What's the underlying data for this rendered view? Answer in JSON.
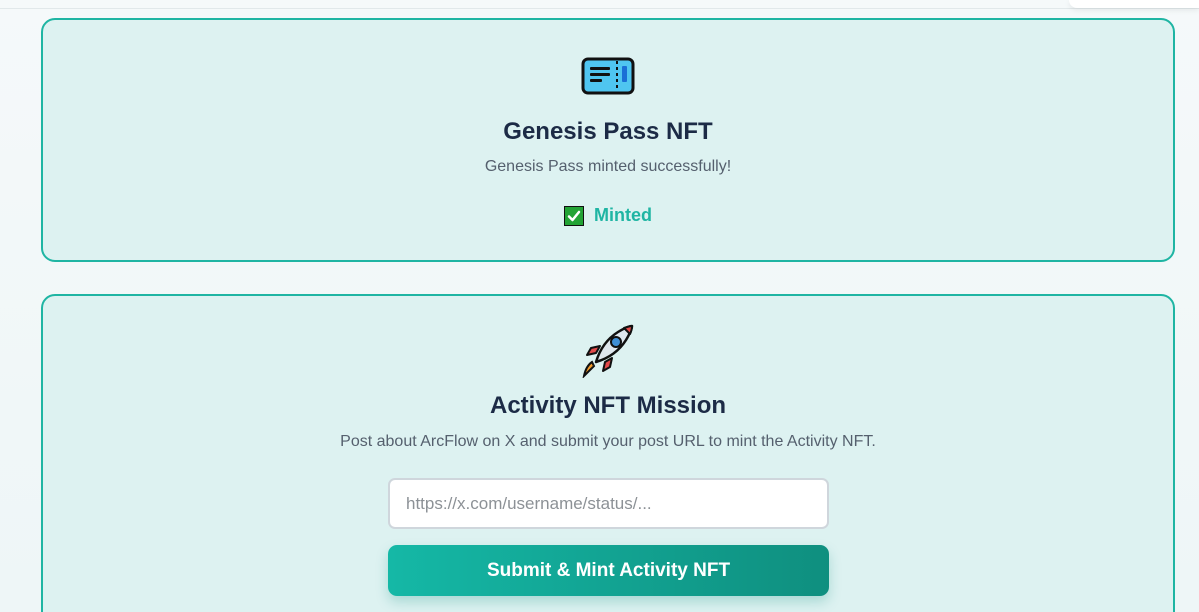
{
  "genesis_card": {
    "icon": "ticket-icon",
    "title": "Genesis Pass NFT",
    "description": "Genesis Pass minted successfully!",
    "status": "Minted",
    "status_icon": "check-mark-icon"
  },
  "activity_card": {
    "icon": "rocket-icon",
    "title": "Activity NFT Mission",
    "description": "Post about ArcFlow on X and submit your post URL to mint the Activity NFT.",
    "url_value": "",
    "url_placeholder": "https://x.com/username/status/...",
    "submit_label": "Submit & Mint Activity NFT"
  },
  "colors": {
    "accent": "#1fb5a3",
    "card_background": "#ddf2f1",
    "title": "#1c2b46",
    "button_gradient_start": "#15b8a6",
    "button_gradient_end": "#0f8f7f",
    "check_green": "#22a335"
  }
}
